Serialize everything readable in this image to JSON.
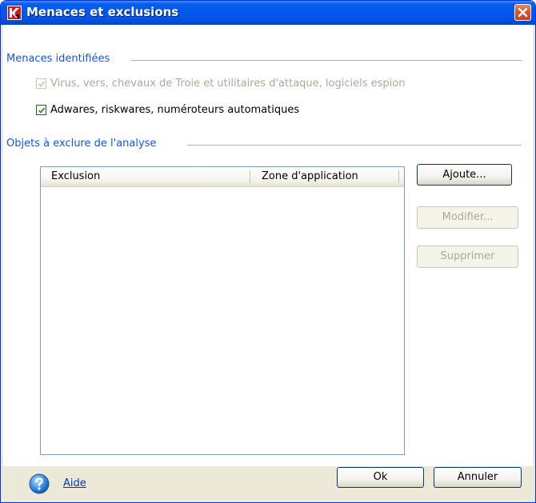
{
  "window": {
    "title": "Menaces et exclusions",
    "icons": {
      "app": "kaspersky-k-icon",
      "close": "close-icon",
      "help": "help-icon"
    }
  },
  "threats_group": {
    "title": "Menaces identifiées",
    "options": [
      {
        "label": "Virus, vers, chevaux de Troie et utilitaires d'attaque, logiciels espion",
        "checked": true,
        "enabled": false
      },
      {
        "label": "Adwares, riskwares, numéroteurs automatiques",
        "checked": true,
        "enabled": true
      }
    ]
  },
  "exclusions_group": {
    "title": "Objets à exclure de l'analyse",
    "columns": [
      "Exclusion",
      "Zone d'application"
    ],
    "rows": [],
    "buttons": {
      "add": "Ajoute...",
      "modify": "Modifier...",
      "delete": "Supprimer"
    }
  },
  "footer": {
    "help": "Aide",
    "ok": "Ok",
    "cancel": "Annuler"
  },
  "colors": {
    "titlebar": "#0058ee",
    "group_title": "#1a56d6",
    "disabled_text": "#aca899",
    "link": "#0033cc"
  }
}
